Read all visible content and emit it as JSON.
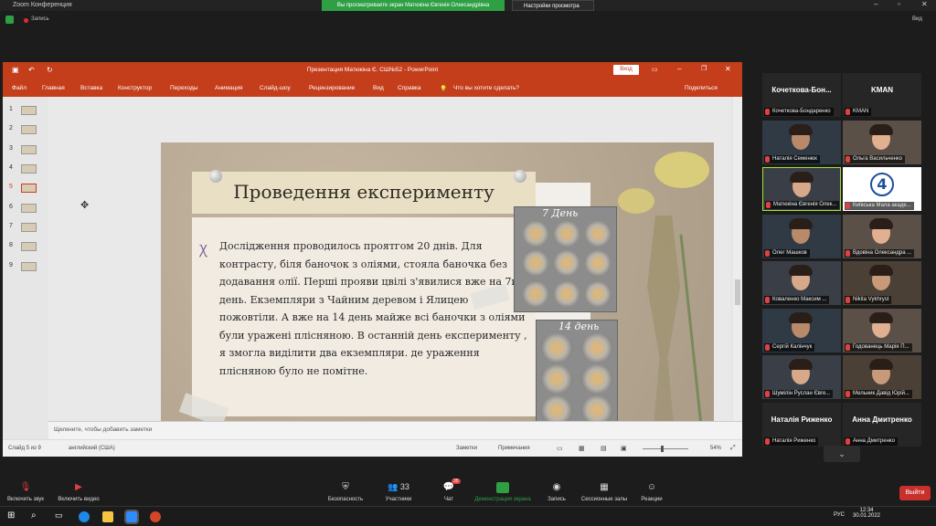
{
  "zoom": {
    "window_title": "Zoom Конференция",
    "share_banner": "Вы просматриваете экран Матюкіна Євгенія Олександрівна",
    "view_options": "Настройки просмотра",
    "recording_label": "Запись",
    "view_button": "Вид"
  },
  "powerpoint": {
    "title": "Презентация Матюкіна Є. СШ№52  -  PowerPoint",
    "login_button": "Вход",
    "ribbon_tabs": [
      "Файл",
      "Главная",
      "Вставка",
      "Конструктор",
      "Переходы",
      "Анимация",
      "Слайд-шоу",
      "Рецензирование",
      "Вид",
      "Справка"
    ],
    "tell_me": "Что вы хотите сделать?",
    "share": "Поделиться",
    "thumbnails": [
      "1",
      "2",
      "3",
      "4",
      "5",
      "6",
      "7",
      "8",
      "9"
    ],
    "selected_slide": 5,
    "notes_placeholder": "Щелкните, чтобы добавить заметки",
    "status": {
      "slide_info": "Слайд 5 из 9",
      "language": "английский (США)",
      "notes_btn": "Заметки",
      "comments_btn": "Примечания",
      "zoom": "54%"
    }
  },
  "slide": {
    "title": "Проведення експерименту",
    "bullet": "Ꭓ",
    "body": "Дослідження проводилось проятгом 20 днів. Для контрасту, біля баночок з оліями, стояла баночка без додавання олії. Перші прояви цвілі з'явилися вже на 7ий день. Екземпляри з Чайним деревом і Ялицею пожовтіли. А вже на 14 день майже всі баночки з оліями були уражені плісняною. В останній день експерименту , я змогла виділити два екземпляри. де ураження плісняною було не помітне.",
    "photo1_label": "7 День",
    "photo2_label": "14 день"
  },
  "participants": [
    {
      "name": "Кочеткова-Бондаренко",
      "display": "Кочеткова-Бон...",
      "type": "text"
    },
    {
      "name": "KMAN",
      "display": "KMAN",
      "type": "text"
    },
    {
      "name": "Наталія Семенюк",
      "type": "video"
    },
    {
      "name": "Ольга Васильченко",
      "type": "video"
    },
    {
      "name": "Матюкіна Євгенія Олек...",
      "type": "video",
      "active": true
    },
    {
      "name": "Київська Мала акаде...",
      "type": "logo",
      "logo_text": "4"
    },
    {
      "name": "Олег Машков",
      "type": "video"
    },
    {
      "name": "Вдовіна Олександра ...",
      "type": "video"
    },
    {
      "name": "Коваленко Максим ...",
      "type": "video"
    },
    {
      "name": "Nikita Vykhryst",
      "type": "video"
    },
    {
      "name": "Сергій Калінчук",
      "type": "video"
    },
    {
      "name": "Годованець Марія П...",
      "type": "video"
    },
    {
      "name": "Шумілін Руслан Євге...",
      "type": "video"
    },
    {
      "name": "Мельник Давід Юрій...",
      "type": "video"
    },
    {
      "name": "Наталія Риженко",
      "display": "Наталія Риженко",
      "type": "text"
    },
    {
      "name": "Анна Дмитренко",
      "display": "Анна Дмитренко",
      "type": "text"
    }
  ],
  "controls": {
    "audio": "Включить звук",
    "video": "Включить видео",
    "security": "Безопасность",
    "participants": "Участники",
    "participants_count": "33",
    "chat": "Чат",
    "chat_badge": "35",
    "share": "Демонстрация экрана",
    "record": "Запись",
    "breakout": "Сессионные залы",
    "reactions": "Реакции",
    "leave": "Выйти"
  },
  "taskbar": {
    "time": "12:34",
    "date": "30.01.2022",
    "lang": "РУС"
  },
  "colors": {
    "ppt_accent": "#c43e1c",
    "zoom_green": "#2ea043",
    "leave_red": "#c9302c"
  }
}
